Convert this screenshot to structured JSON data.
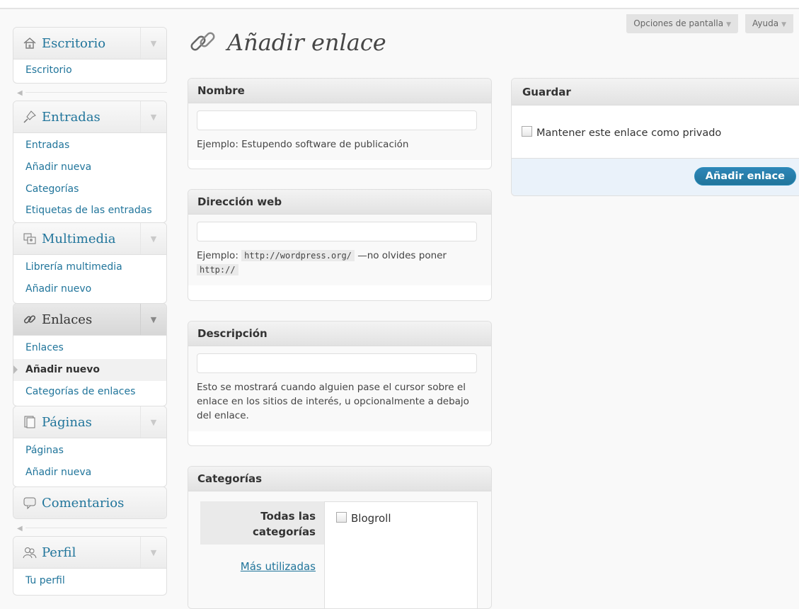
{
  "screen_tabs": {
    "screen_options": "Opciones de pantalla",
    "help": "Ayuda"
  },
  "sidebar": {
    "dashboard": {
      "label": "Escritorio",
      "items": [
        "Escritorio"
      ]
    },
    "posts": {
      "label": "Entradas",
      "items": [
        "Entradas",
        "Añadir nueva",
        "Categorías",
        "Etiquetas de las entradas"
      ]
    },
    "media": {
      "label": "Multimedia",
      "items": [
        "Librería multimedia",
        "Añadir nuevo"
      ]
    },
    "links": {
      "label": "Enlaces",
      "items": [
        "Enlaces",
        "Añadir nuevo",
        "Categorías de enlaces"
      ]
    },
    "pages": {
      "label": "Páginas",
      "items": [
        "Páginas",
        "Añadir nueva"
      ]
    },
    "comments": {
      "label": "Comentarios"
    },
    "profile": {
      "label": "Perfil",
      "items": [
        "Tu perfil"
      ]
    }
  },
  "page": {
    "title": "Añadir enlace"
  },
  "name_box": {
    "title": "Nombre",
    "value": "",
    "hint": "Ejemplo: Estupendo software de publicación"
  },
  "url_box": {
    "title": "Dirección web",
    "value": "",
    "hint_prefix": "Ejemplo:",
    "hint_code": "http://wordpress.org/",
    "hint_mid": "—no olvides poner",
    "hint_code2": "http://"
  },
  "desc_box": {
    "title": "Descripción",
    "value": "",
    "hint": "Esto se mostrará cuando alguien pase el cursor sobre el enlace en los sitios de interés, u opcionalmente a debajo del enlace."
  },
  "categories_box": {
    "title": "Categorías",
    "tab_all": "Todas las categorías",
    "tab_popular": "Más utilizadas",
    "items": [
      "Blogroll"
    ]
  },
  "save_box": {
    "title": "Guardar",
    "private_label": "Mantener este enlace como privado",
    "submit": "Añadir enlace"
  },
  "colors": {
    "link": "#21759b",
    "primary_button": "#21759b",
    "footer_bg": "#eaf2fa"
  }
}
